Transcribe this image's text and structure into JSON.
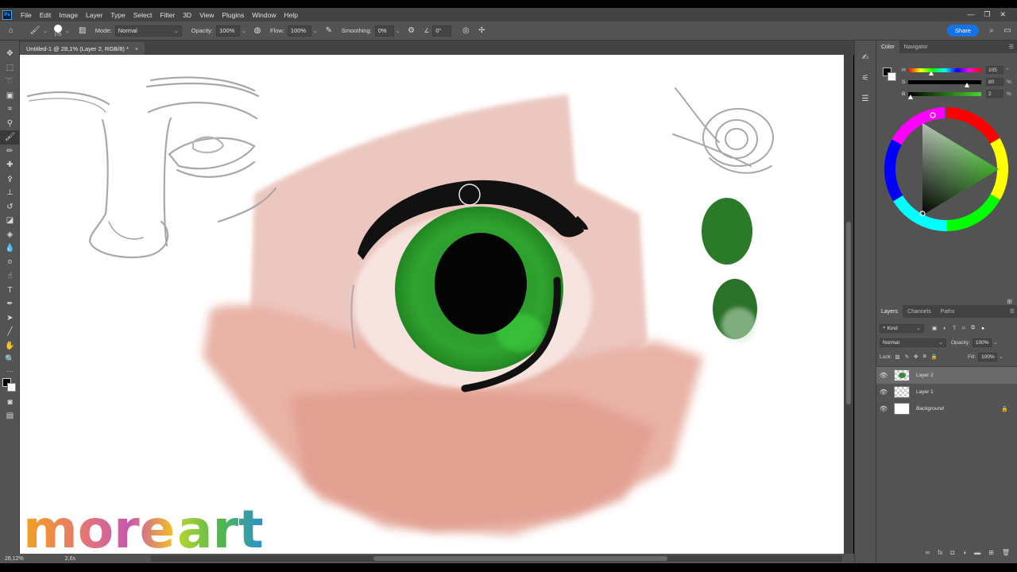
{
  "app": {
    "logo": "Ps"
  },
  "menu": [
    "File",
    "Edit",
    "Image",
    "Layer",
    "Type",
    "Select",
    "Filter",
    "3D",
    "View",
    "Plugins",
    "Window",
    "Help"
  ],
  "window_controls": {
    "minimize": "—",
    "restore": "❐",
    "close": "✕"
  },
  "options": {
    "brush_size": "175",
    "mode_label": "Mode:",
    "mode_value": "Normal",
    "opacity_label": "Opacity:",
    "opacity_value": "100%",
    "flow_label": "Flow:",
    "flow_value": "100%",
    "smoothing_label": "Smoothing:",
    "smoothing_value": "0%",
    "angle_value": "0°",
    "share_label": "Share"
  },
  "document_tab": {
    "title": "Untitled-1 @ 28,1% (Layer 2, RGB/8) *",
    "close": "×"
  },
  "status": {
    "zoom": "28,12%",
    "info": "2,6s"
  },
  "color_panel": {
    "tabs": [
      "Color",
      "Navigator"
    ],
    "h_label": "H",
    "h_value": "105",
    "s_label": "S",
    "s_value": "80",
    "s_unit": "%",
    "b_label": "B",
    "b_value": "2",
    "b_unit": "%",
    "foreground": "#050505",
    "background": "#ffffff",
    "hue_color": "#44d62c"
  },
  "layers_panel": {
    "tabs": [
      "Layers",
      "Channels",
      "Paths"
    ],
    "filter_label": "Kind",
    "blend_mode": "Normal",
    "opacity_label": "Opacity:",
    "opacity_value": "100%",
    "lock_label": "Lock:",
    "fill_label": "Fill:",
    "fill_value": "100%",
    "layers": [
      {
        "name": "Layer 2",
        "selected": true
      },
      {
        "name": "Layer 1",
        "selected": false
      },
      {
        "name": "Background",
        "selected": false,
        "locked": true
      }
    ]
  },
  "watermark": {
    "word1": "more",
    "word2": "art"
  }
}
